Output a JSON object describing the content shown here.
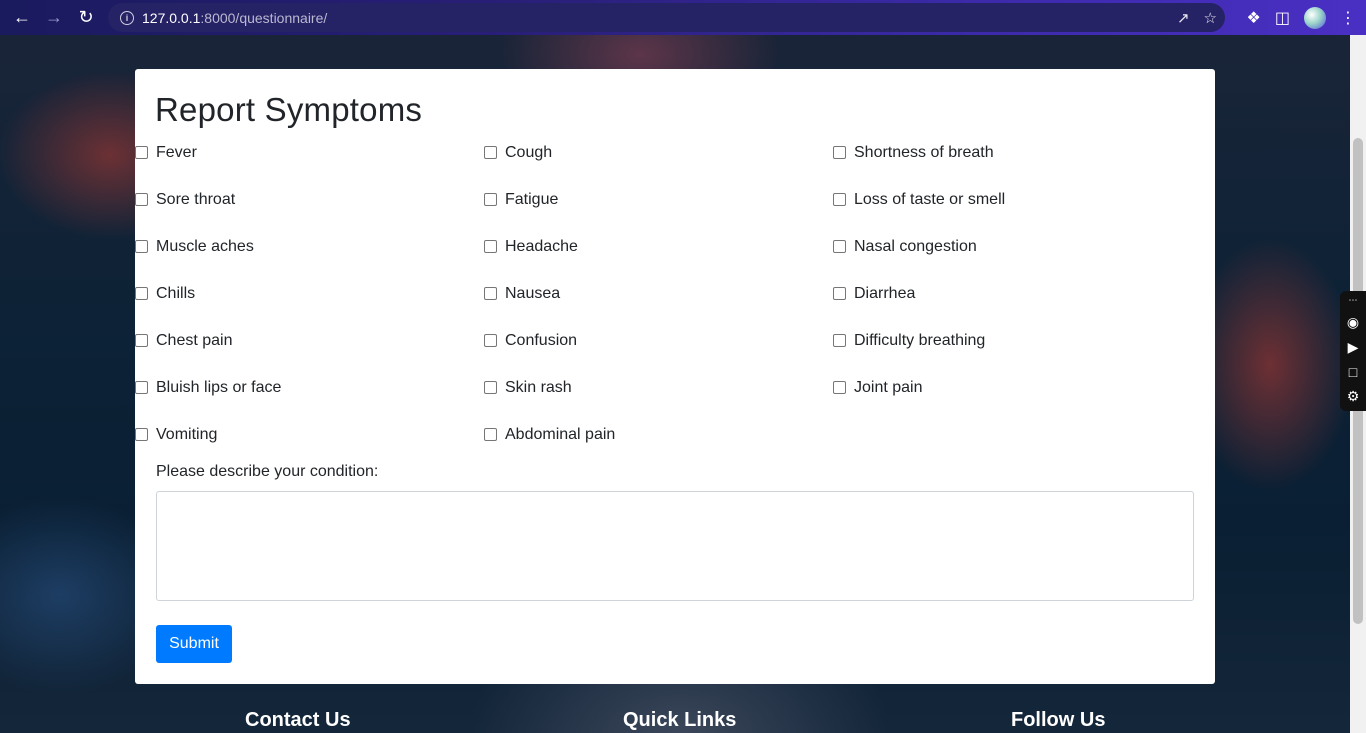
{
  "browser": {
    "url_host": "127.0.0.1",
    "url_rest": ":8000/questionnaire/"
  },
  "form": {
    "title": "Report Symptoms",
    "symptoms": [
      "Fever",
      "Cough",
      "Shortness of breath",
      "Sore throat",
      "Fatigue",
      "Loss of taste or smell",
      "Muscle aches",
      "Headache",
      "Nasal congestion",
      "Chills",
      "Nausea",
      "Diarrhea",
      "Chest pain",
      "Confusion",
      "Difficulty breathing",
      "Bluish lips or face",
      "Skin rash",
      "Joint pain",
      "Vomiting",
      "Abdominal pain"
    ],
    "description_label": "Please describe your condition:",
    "description_value": "",
    "submit_label": "Submit"
  },
  "footer": {
    "contact": "Contact Us",
    "links": "Quick Links",
    "follow": "Follow Us"
  },
  "colors": {
    "primary_button": "#007bff",
    "card": "#ffffff"
  }
}
